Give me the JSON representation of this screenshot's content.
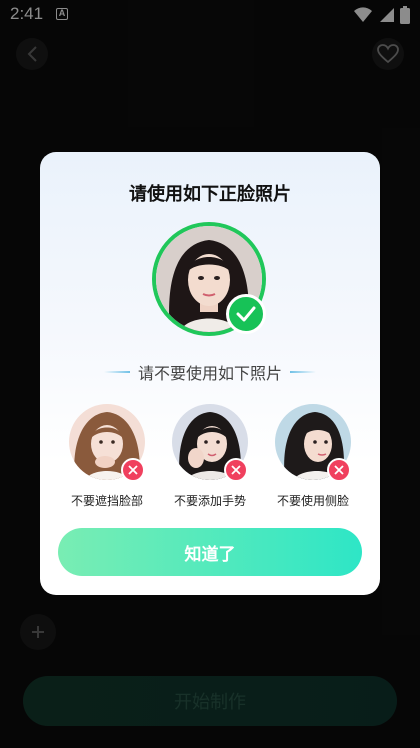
{
  "status_bar": {
    "time": "2:41",
    "badge_letter": "A"
  },
  "bottom": {
    "start_label": "开始制作"
  },
  "dialog": {
    "title": "请使用如下正脸照片",
    "subtitle": "请不要使用如下照片",
    "bad_examples": [
      {
        "label": "不要遮挡脸部"
      },
      {
        "label": "不要添加手势"
      },
      {
        "label": "不要使用侧脸"
      }
    ],
    "confirm_label": "知道了"
  },
  "colors": {
    "accent_green": "#20c75a",
    "error_red": "#f0405e",
    "button_gradient_start": "#79edb3",
    "button_gradient_end": "#2ee6c6"
  }
}
